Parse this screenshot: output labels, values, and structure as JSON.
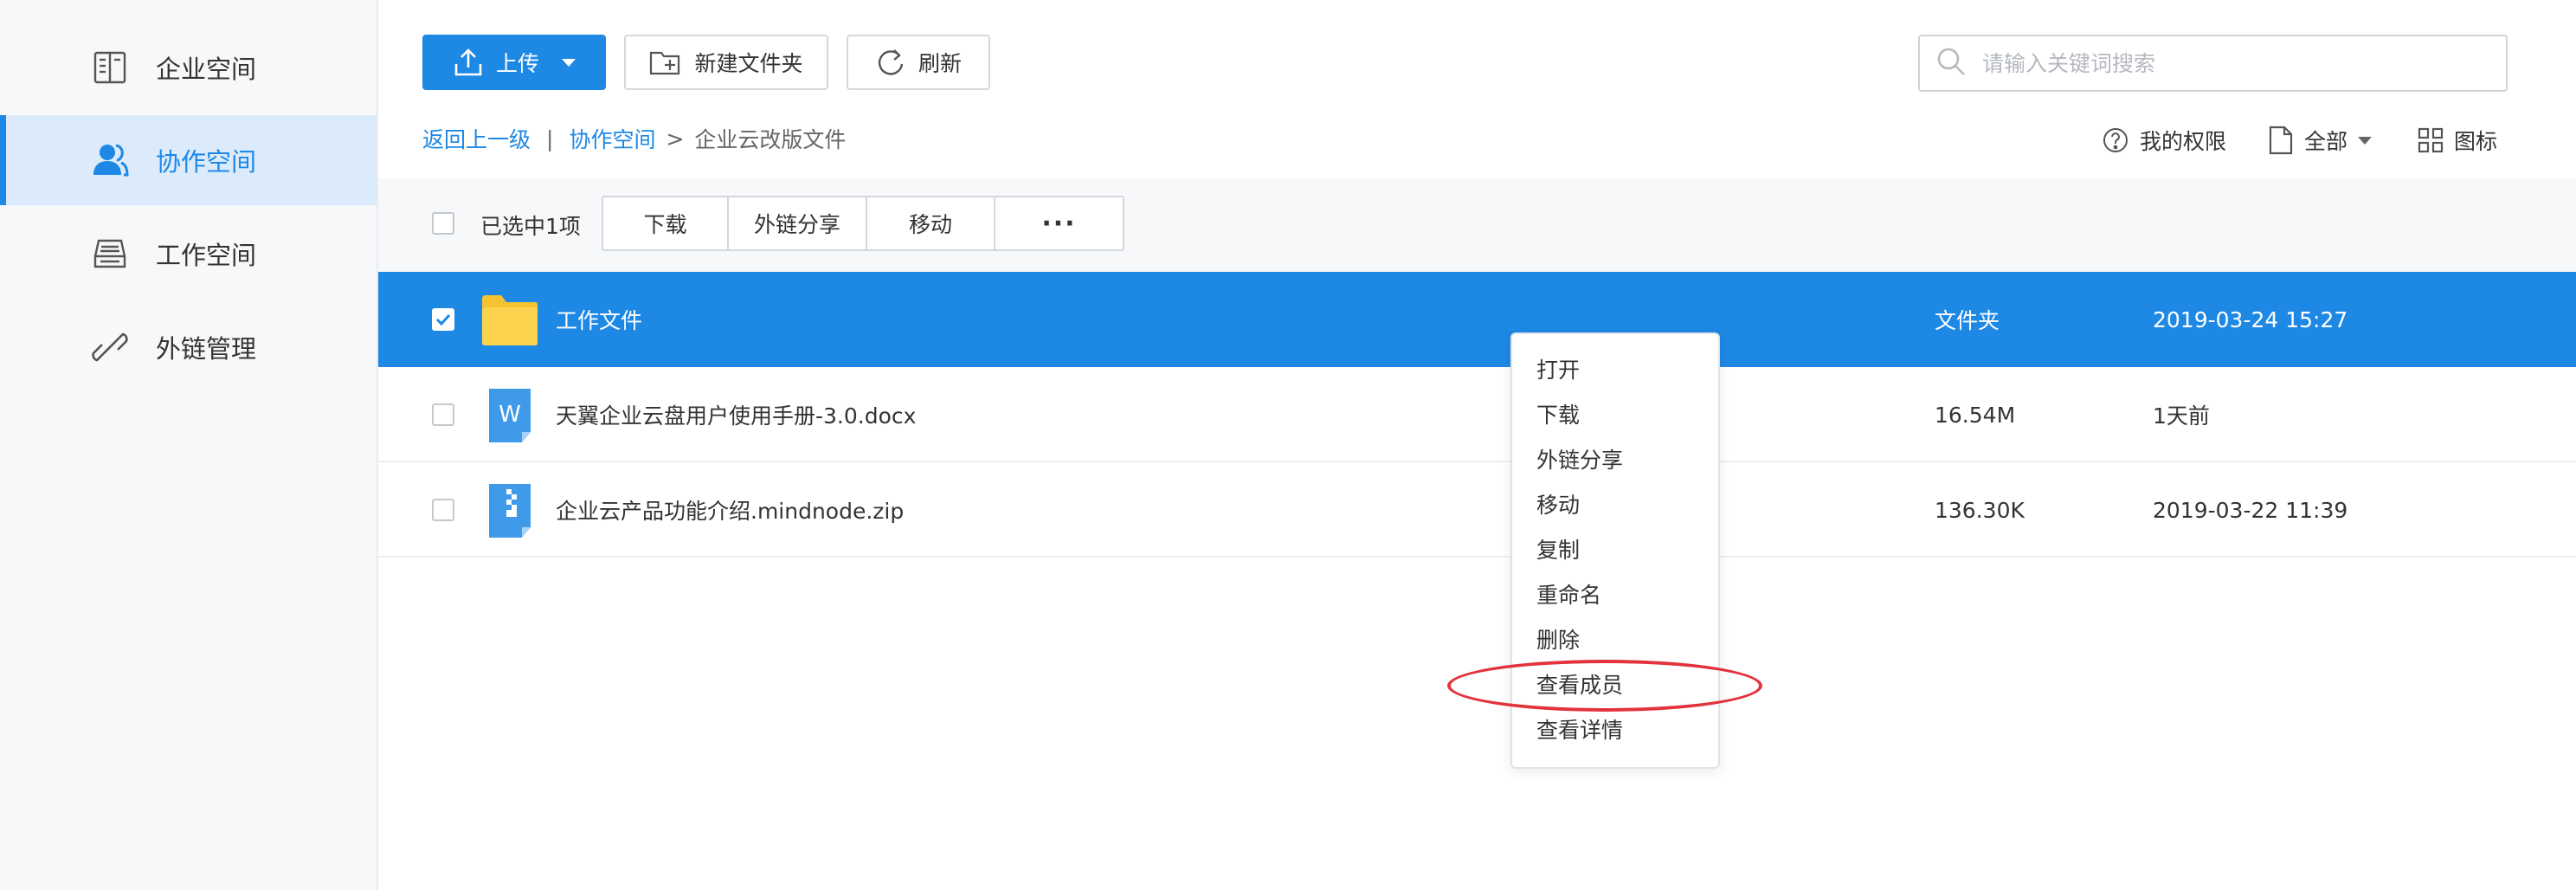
{
  "sidebar": {
    "items": [
      {
        "label": "企业空间",
        "icon": "building-icon",
        "active": false
      },
      {
        "label": "协作空间",
        "icon": "users-icon",
        "active": true
      },
      {
        "label": "工作空间",
        "icon": "inbox-tray-icon",
        "active": false
      },
      {
        "label": "外链管理",
        "icon": "link-icon",
        "active": false
      }
    ]
  },
  "toolbar": {
    "upload_label": "上传",
    "new_folder_label": "新建文件夹",
    "refresh_label": "刷新"
  },
  "search": {
    "placeholder": "请输入关键词搜索"
  },
  "breadcrumb": {
    "back": "返回上一级",
    "separator": "|",
    "space": "协作空间",
    "arrow": ">",
    "current": "企业云改版文件"
  },
  "view_options": {
    "permissions_label": "我的权限",
    "filter_label": "全部",
    "view_label": "图标"
  },
  "selection": {
    "count_label": "已选中1项",
    "actions": {
      "download": "下载",
      "share": "外链分享",
      "move": "移动",
      "more": "···"
    }
  },
  "files": [
    {
      "name": "工作文件",
      "type": "文件夹",
      "date": "2019-03-24 15:27",
      "selected": true,
      "icon": "folder-icon"
    },
    {
      "name": "天翼企业云盘用户使用手册-3.0.docx",
      "type": "16.54M",
      "date": "1天前",
      "selected": false,
      "icon": "word-doc-icon",
      "icon_letter": "W"
    },
    {
      "name": "企业云产品功能介绍.mindnode.zip",
      "type": "136.30K",
      "date": "2019-03-22 11:39",
      "selected": false,
      "icon": "zip-file-icon"
    }
  ],
  "context_menu": {
    "items": [
      "打开",
      "下载",
      "外链分享",
      "移动",
      "复制",
      "重命名",
      "删除",
      "查看成员",
      "查看详情"
    ],
    "highlighted": "查看成员"
  },
  "colors": {
    "accent": "#1e88e5",
    "sidebar_bg": "#f7f8fa",
    "active_nav_bg": "#dcebfb",
    "folder": "#fcd34d",
    "annotation": "#e2333d"
  }
}
